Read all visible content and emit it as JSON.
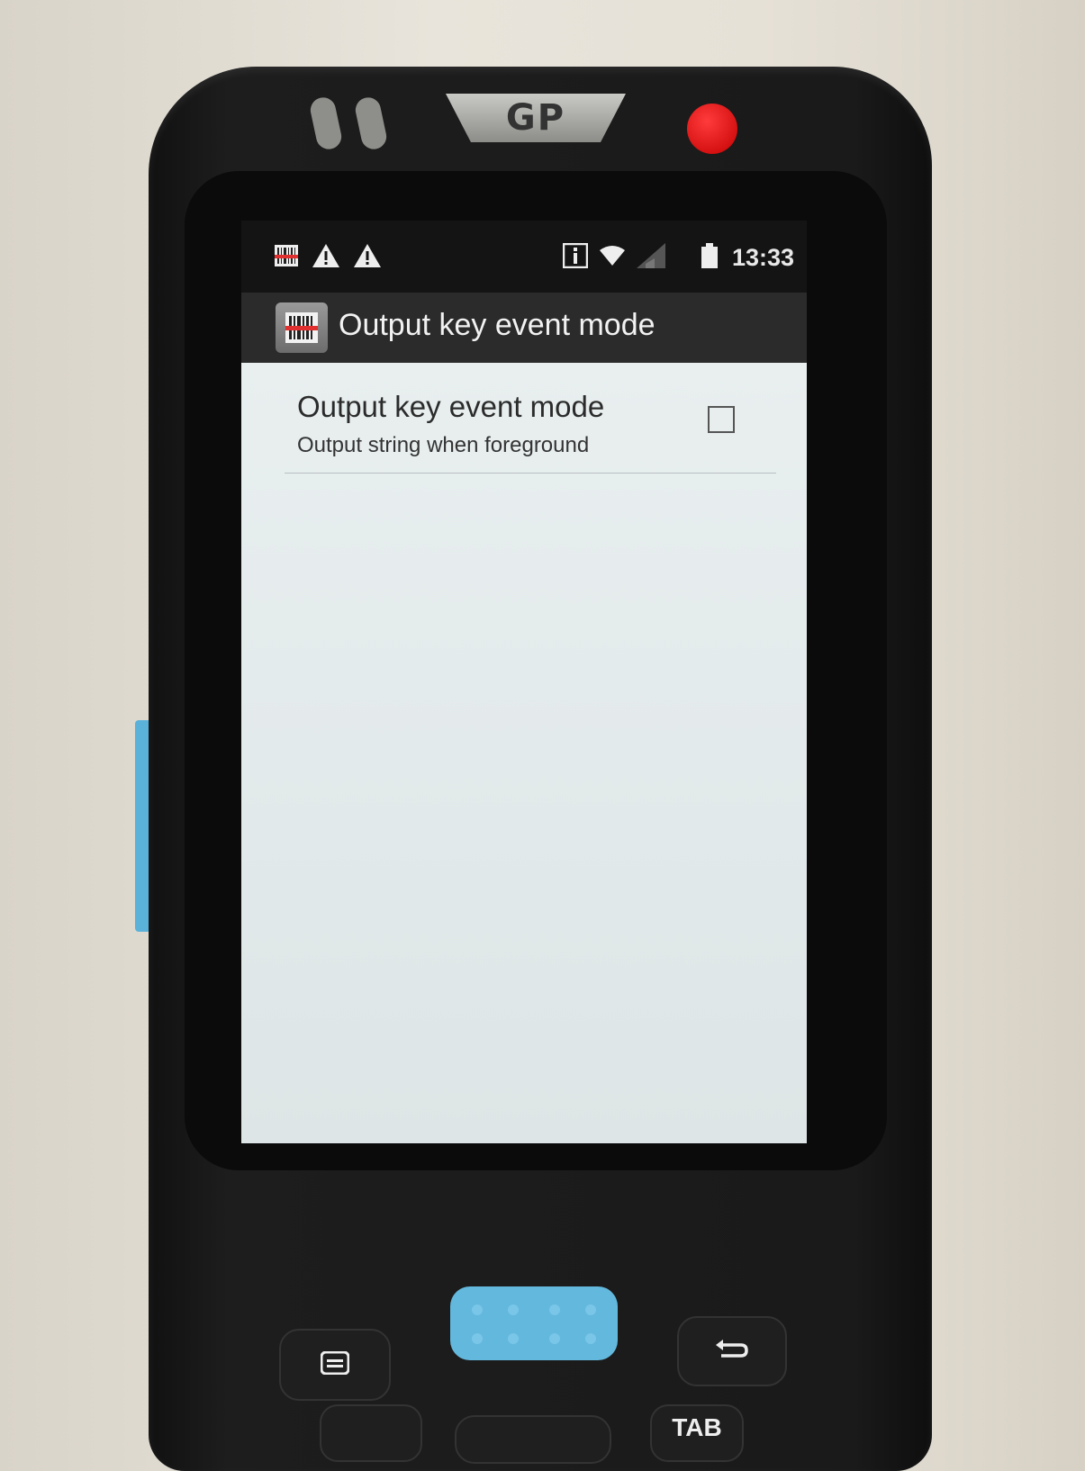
{
  "device": {
    "brand_logo": "GP",
    "brand_color": "#c9c9c5",
    "record_color": "#e00000",
    "scan_key_color": "#63b8dd"
  },
  "status_bar": {
    "time": "13:33",
    "left_icons": [
      "barcode-scanner-icon",
      "warning-icon",
      "warning-icon"
    ],
    "right_icons": [
      "info-icon",
      "wifi-icon",
      "signal-icon",
      "battery-icon"
    ]
  },
  "action_bar": {
    "app_icon": "barcode-scanner-icon",
    "title": "Output key event mode"
  },
  "preference": {
    "title": "Output key event mode",
    "summary": "Output string when foreground",
    "checked": false
  },
  "keypad": {
    "menu_icon": "menu-icon",
    "back_icon": "back-arrow-icon",
    "tab_label": "TAB"
  }
}
